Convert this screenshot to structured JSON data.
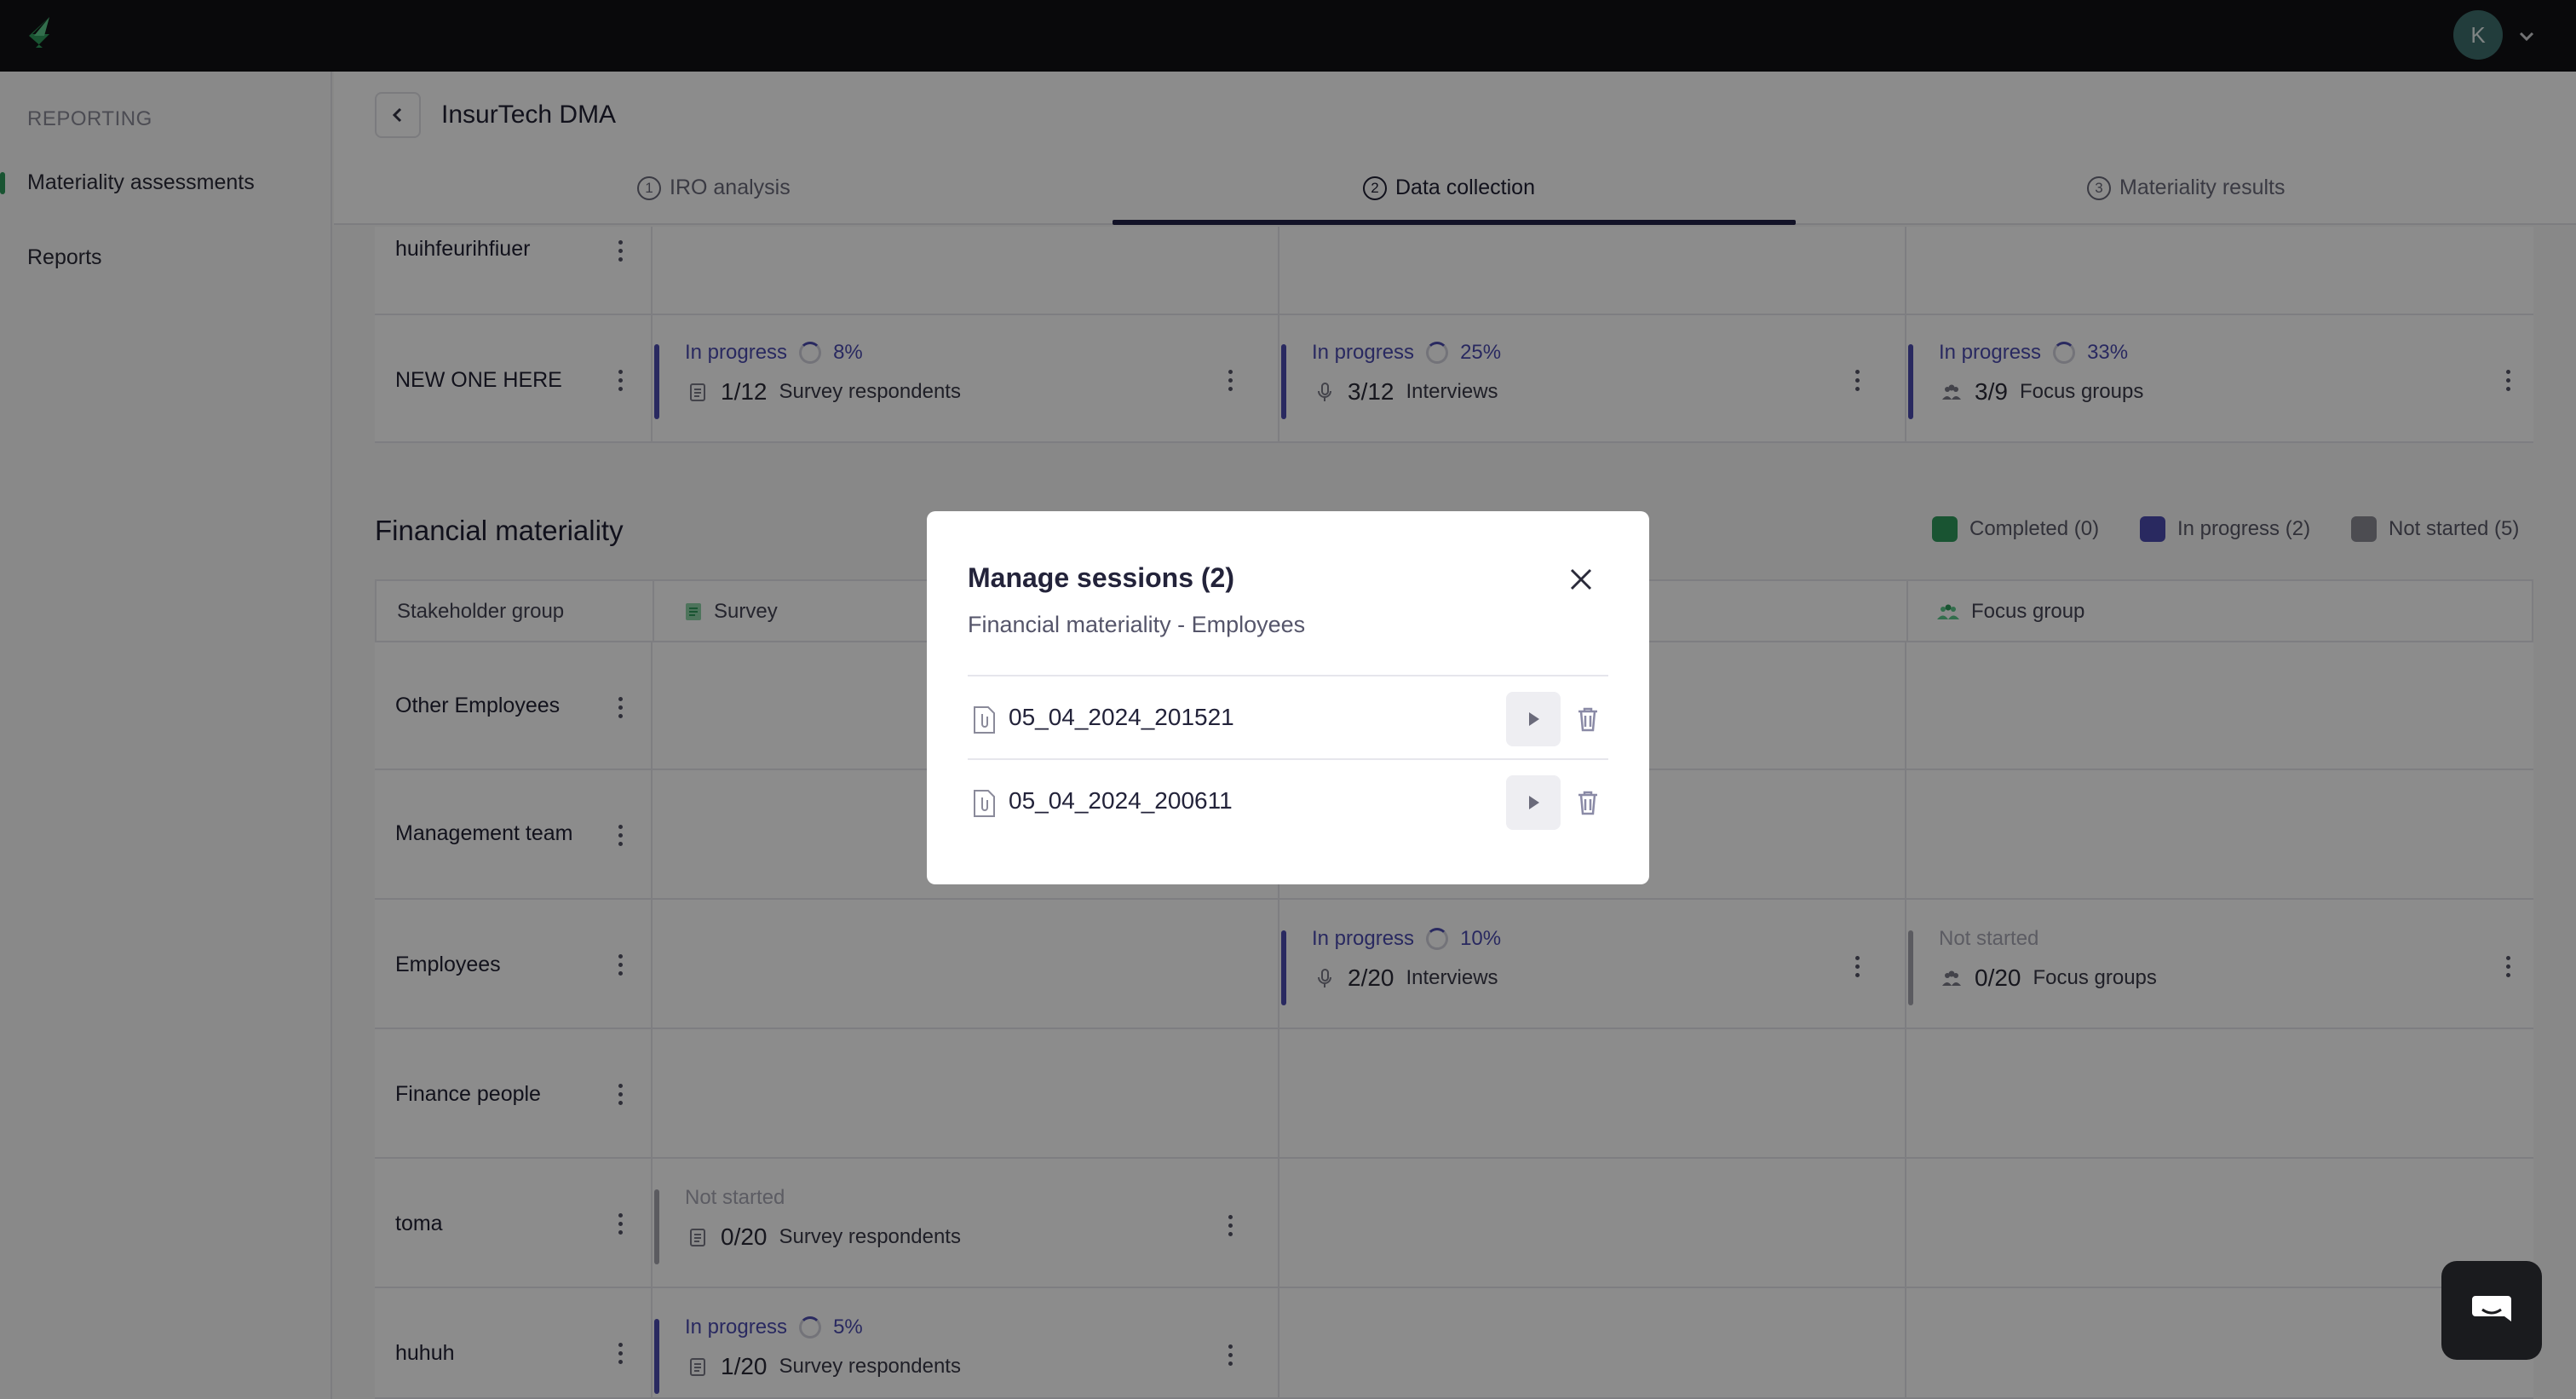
{
  "topbar": {
    "avatar_initial": "K"
  },
  "sidebar": {
    "section": "REPORTING",
    "items": [
      {
        "label": "Materiality assessments",
        "active": true
      },
      {
        "label": "Reports",
        "active": false
      }
    ]
  },
  "header": {
    "title": "InsurTech DMA",
    "tabs": [
      {
        "num": "1",
        "label": "IRO analysis"
      },
      {
        "num": "2",
        "label": "Data collection",
        "active": true
      },
      {
        "num": "3",
        "label": "Materiality results"
      }
    ]
  },
  "impact_rows": [
    {
      "label": "huihfeurihfiuer"
    },
    {
      "label": "NEW ONE HERE",
      "survey": {
        "status": "In progress",
        "percent": "8%",
        "count": "1/12",
        "unit": "Survey respondents"
      },
      "interview": {
        "status": "In progress",
        "percent": "25%",
        "count": "3/12",
        "unit": "Interviews"
      },
      "focus": {
        "status": "In progress",
        "percent": "33%",
        "count": "3/9",
        "unit": "Focus groups"
      }
    }
  ],
  "financial": {
    "title": "Financial materiality",
    "legend": [
      {
        "label": "Completed (0)",
        "color": "#2f9a5b"
      },
      {
        "label": "In progress (2)",
        "color": "#4b4bb0"
      },
      {
        "label": "Not started (5)",
        "color": "#8a8a94"
      }
    ],
    "columns": {
      "group": "Stakeholder group",
      "survey": "Survey",
      "focus": "Focus group"
    },
    "rows": [
      {
        "label": "Other Employees"
      },
      {
        "label": "Management team"
      },
      {
        "label": "Employees",
        "interview": {
          "status": "In progress",
          "percent": "10%",
          "count": "2/20",
          "unit": "Interviews"
        },
        "focus": {
          "status": "Not started",
          "count": "0/20",
          "unit": "Focus groups"
        }
      },
      {
        "label": "Finance people"
      },
      {
        "label": "toma",
        "survey": {
          "status": "Not started",
          "count": "0/20",
          "unit": "Survey respondents"
        }
      },
      {
        "label": "huhuh",
        "survey": {
          "status": "In progress",
          "percent": "5%",
          "count": "1/20",
          "unit": "Survey respondents"
        }
      }
    ]
  },
  "modal": {
    "title": "Manage sessions (2)",
    "subtitle": "Financial materiality - Employees",
    "sessions": [
      {
        "name": "05_04_2024_201521"
      },
      {
        "name": "05_04_2024_200611"
      }
    ]
  },
  "colors": {
    "accent": "#4b4bb0",
    "brand": "#2f9a5b",
    "topbar": "#111214"
  }
}
